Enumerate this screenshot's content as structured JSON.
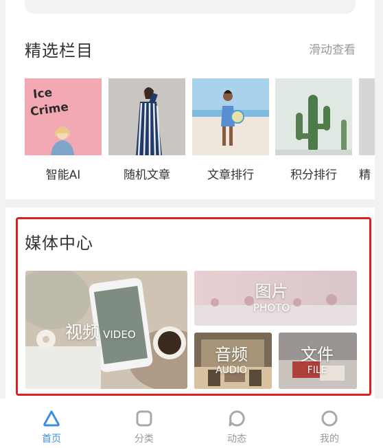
{
  "featured": {
    "title": "精选栏目",
    "scroll_hint": "滑动查看",
    "items": [
      {
        "label": "智能AI",
        "icon": "ice-crime-poster-image"
      },
      {
        "label": "随机文章",
        "icon": "striped-dress-image"
      },
      {
        "label": "文章排行",
        "icon": "beach-girl-image"
      },
      {
        "label": "积分排行",
        "icon": "cactus-image"
      },
      {
        "label": "精",
        "icon": "partial-item-image"
      }
    ],
    "poster_text": "Ice Crime"
  },
  "media": {
    "title": "媒体中心",
    "tiles": {
      "video": {
        "cn": "视频",
        "en": "VIDEO"
      },
      "photo": {
        "cn": "图片",
        "en": "PHOTO"
      },
      "audio": {
        "cn": "音频",
        "en": "AUDIO"
      },
      "file": {
        "cn": "文件",
        "en": "FILE"
      }
    }
  },
  "tabbar": {
    "items": [
      {
        "label": "首页",
        "icon": "home-triangle-icon",
        "active": true
      },
      {
        "label": "分类",
        "icon": "category-square-icon"
      },
      {
        "label": "动态",
        "icon": "moments-bubble-icon"
      },
      {
        "label": "我的",
        "icon": "profile-circle-icon"
      }
    ],
    "active_color": "#3a8ee6",
    "inactive_color": "#999999"
  }
}
